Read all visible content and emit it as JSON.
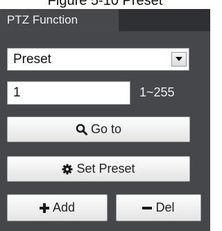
{
  "caption": "Figure 5-10 Preset",
  "panel": {
    "tab_label": "PTZ Function",
    "function_select": {
      "selected": "Preset"
    },
    "preset_input": {
      "value": "1"
    },
    "range_label": "1~255",
    "buttons": {
      "goto": {
        "label": "Go to",
        "icon": "search-icon"
      },
      "set_preset": {
        "label": "Set Preset",
        "icon": "gear-icon"
      },
      "add": {
        "label": "Add",
        "icon": "plus-icon"
      },
      "del": {
        "label": "Del",
        "icon": "minus-icon"
      }
    }
  },
  "colors": {
    "panel_bg": "#45474a",
    "tabbar_bg": "#2e3033",
    "tab_bg": "#46484b",
    "button_bg": "#f2f2f2"
  }
}
